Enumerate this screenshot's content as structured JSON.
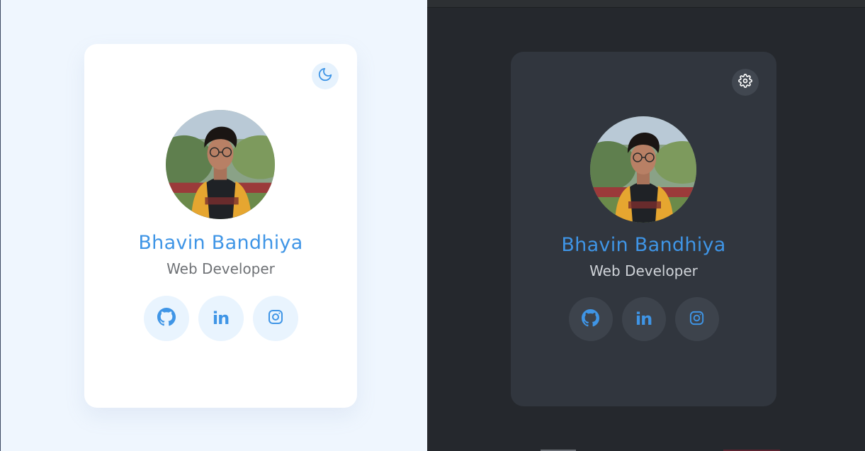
{
  "profile": {
    "name": "Bhavin Bandhiya",
    "role": "Web Developer"
  },
  "light_card": {
    "theme_toggle_icon": "moon-icon"
  },
  "dark_card": {
    "theme_toggle_icon": "gear-icon"
  },
  "socials": [
    {
      "icon": "github-icon"
    },
    {
      "icon": "linkedin-icon",
      "glyph": "in"
    },
    {
      "icon": "instagram-icon"
    }
  ],
  "colors": {
    "accent": "#3f95e6",
    "light_bg": "#eff6fe",
    "dark_bg": "#25282d",
    "dark_card": "#31363e"
  }
}
